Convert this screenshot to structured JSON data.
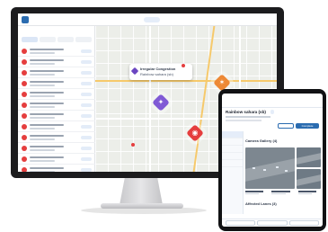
{
  "desktop": {
    "map_tooltip": {
      "title": "Irregular Congestion",
      "subtitle": "Rainbow sahara (sb)"
    },
    "event_icon_colors": [
      "#e53e3e",
      "#e53e3e",
      "#e53e3e",
      "#e53e3e",
      "#e53e3e",
      "#e53e3e",
      "#e53e3e",
      "#e53e3e",
      "#e53e3e",
      "#e53e3e",
      "#e53e3e",
      "#e53e3e"
    ],
    "pins": [
      {
        "name": "congestion-pin",
        "color": "#805ad5",
        "glyph": "✦"
      },
      {
        "name": "construction-pin",
        "color": "#ed8936",
        "glyph": "✶"
      },
      {
        "name": "incident-pin",
        "color": "#e53e3e",
        "glyph": "◉"
      }
    ]
  },
  "tablet": {
    "event_title": "Rainbow sahara (sb)",
    "camera_section": "Camera Gallery (4)",
    "lanes_section": "Affected Lanes (3)",
    "actions": {
      "complete": "Complete"
    }
  }
}
